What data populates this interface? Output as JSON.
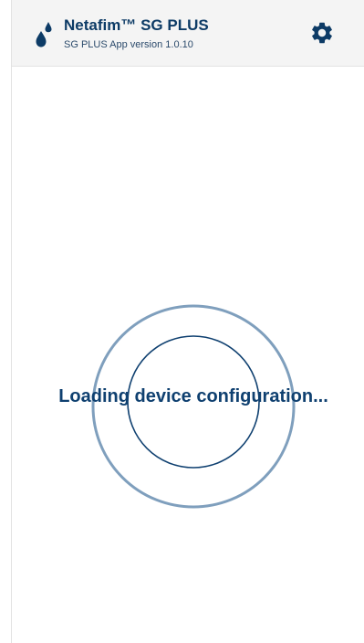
{
  "header": {
    "title": "Netafim™ SG PLUS",
    "subtitle": "SG PLUS App version 1.0.10",
    "logo_icon": "water-drops-icon",
    "settings_icon": "gear-icon"
  },
  "main": {
    "loading_text": "Loading device configuration..."
  },
  "colors": {
    "brand": "#0d3b66",
    "header_bg": "#f4f4f4",
    "outer_ring": "#7f9fbd",
    "inner_ring": "#0f4070"
  }
}
